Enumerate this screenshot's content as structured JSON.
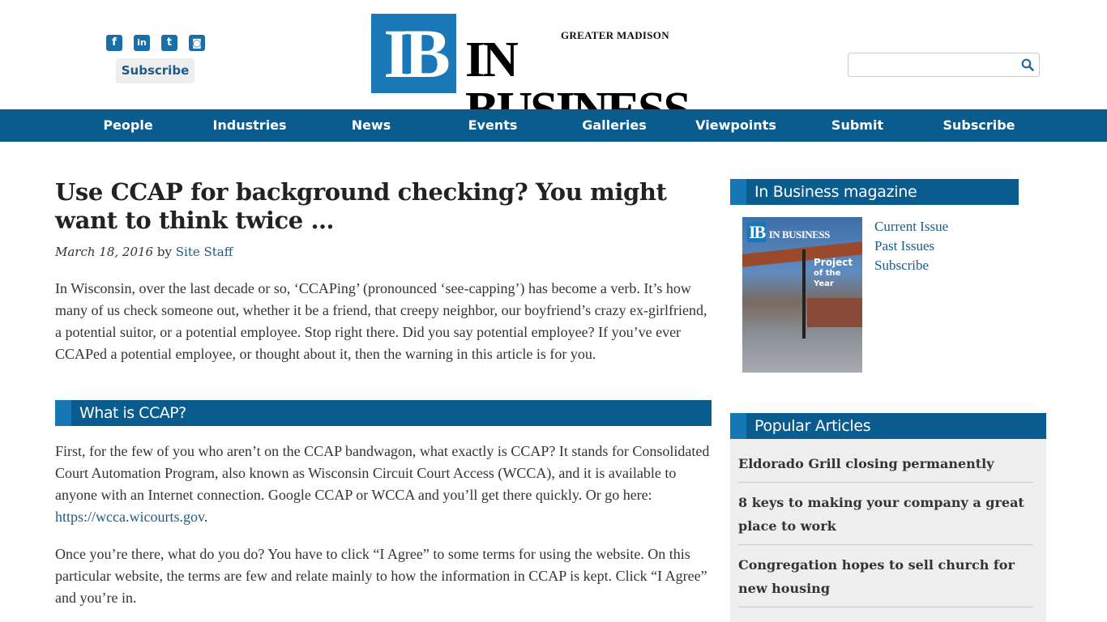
{
  "header": {
    "social": [
      {
        "name": "facebook-icon",
        "glyph": "f"
      },
      {
        "name": "linkedin-icon",
        "glyph": "in"
      },
      {
        "name": "twitter-icon",
        "glyph": "t"
      },
      {
        "name": "instagram-icon",
        "glyph": "◙"
      }
    ],
    "subscribe_label": "Subscribe",
    "logo": {
      "mark": "IB",
      "small": "GREATER MADISON",
      "big": "IN BUSINESS"
    },
    "search": {
      "placeholder": "",
      "value": ""
    }
  },
  "nav": {
    "items": [
      {
        "label": "People"
      },
      {
        "label": "Industries"
      },
      {
        "label": "News"
      },
      {
        "label": "Events"
      },
      {
        "label": "Galleries"
      },
      {
        "label": "Viewpoints"
      },
      {
        "label": "Submit"
      },
      {
        "label": "Subscribe"
      }
    ]
  },
  "article": {
    "title": "Use CCAP for background checking? You might want to think twice …",
    "date": "March 18, 2016",
    "by": "by",
    "author": "Site Staff",
    "p1": "In Wisconsin, over the last decade or so, ‘CCAPing’ (pronounced ‘see-capping’) has become a verb. It’s how many of us check someone out, whether it be a friend, that creepy neighbor, our boyfriend’s crazy ex-girlfriend, a potential suitor, or a potential employee. Stop right there. Did you say potential employee? If you’ve ever CCAPed a potential employee, or thought about it, then the warning in this article is for you.",
    "h2": "What is CCAP?",
    "p2_text": "First, for the few of you who aren’t on the CCAP bandwagon, what exactly is CCAP? It stands for Consolidated Court Automation Program, also known as Wisconsin Circuit Court Access (WCCA), and it is available to anyone with an Internet connection. Google CCAP or WCCA and you’ll get there quickly. Or go here: ",
    "p2_link": "https://wcca.wicourts.gov",
    "p2_end": ".",
    "p3": "Once you’re there, what do you do? You have to click “I Agree” to some terms for using the website. On this particular website, the terms are few and relate mainly to how the information in CCAP is kept. Click “I Agree” and you’re in."
  },
  "sidebar": {
    "magazine": {
      "heading": "In Business magazine",
      "cover_title_1": "Project",
      "cover_title_2": "of the Year",
      "links": [
        {
          "label": "Current Issue"
        },
        {
          "label": "Past Issues"
        },
        {
          "label": "Subscribe"
        }
      ]
    },
    "popular": {
      "heading": "Popular Articles",
      "items": [
        {
          "label": "Eldorado Grill closing permanently"
        },
        {
          "label": "8 keys to making your company a great place to work"
        },
        {
          "label": "Congregation hopes to sell church for new housing"
        }
      ]
    }
  },
  "colors": {
    "nav_bg": "#0a5c8e",
    "accent": "#1677b5",
    "link": "#1e5b86"
  }
}
